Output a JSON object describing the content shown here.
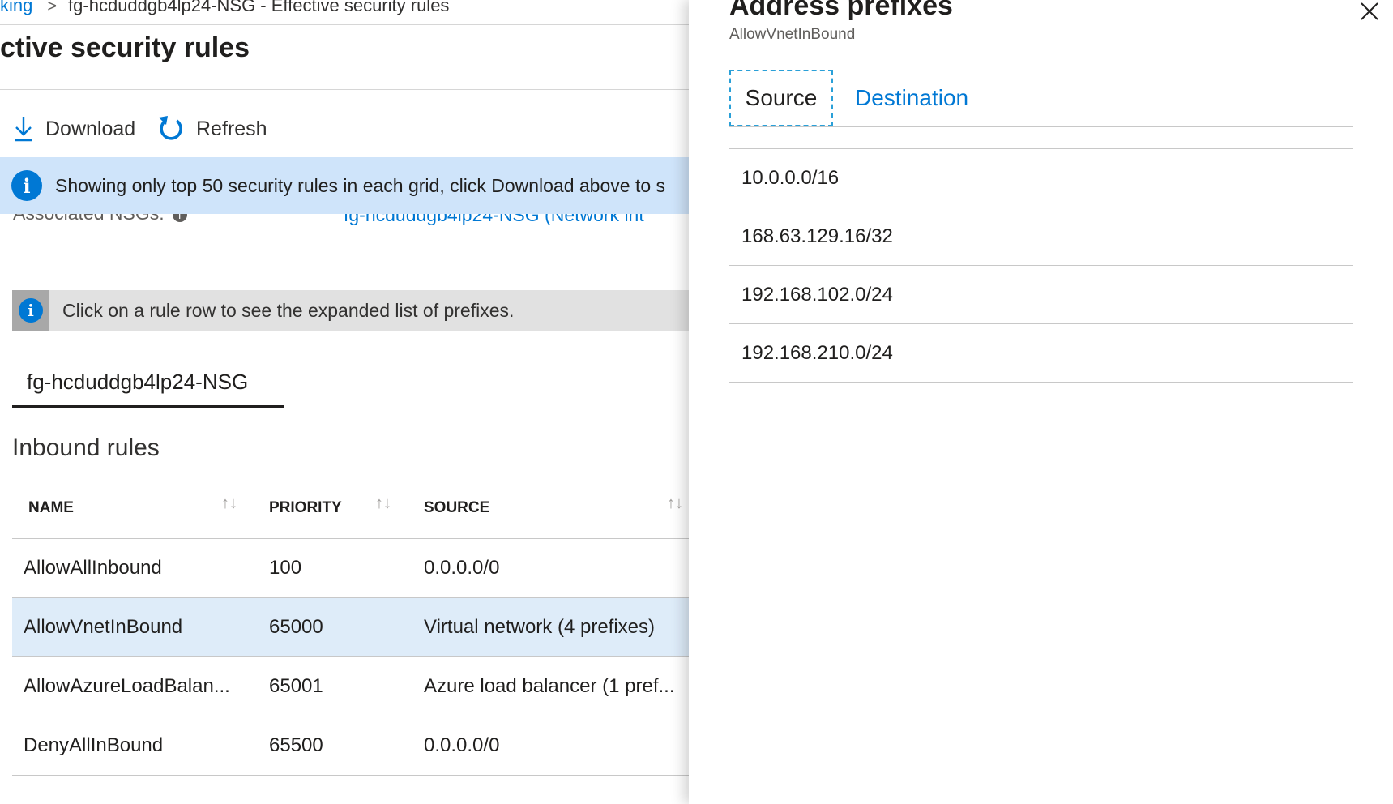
{
  "breadcrumb": {
    "link": "king",
    "separator": ">",
    "current": "fg-hcduddgb4lp24-NSG - Effective security rules"
  },
  "page": {
    "title": "ctive security rules"
  },
  "toolbar": {
    "download_label": "Download",
    "refresh_label": "Refresh"
  },
  "info_banner": {
    "text": "Showing only top 50 security rules in each grid, click Download above to s"
  },
  "associated": {
    "label": "Associated NSGs:",
    "value": "fg-hcduddgb4lp24-NSG (Network int"
  },
  "hint_banner": {
    "text": "Click on a rule row to see the expanded list of prefixes."
  },
  "nsg_tab": {
    "label": "fg-hcduddgb4lp24-NSG"
  },
  "inbound": {
    "title": "Inbound rules",
    "columns": [
      "NAME",
      "PRIORITY",
      "SOURCE"
    ],
    "sort_glyph": "↑↓",
    "rows": [
      {
        "name": "AllowAllInbound",
        "priority": "100",
        "source": "0.0.0.0/0"
      },
      {
        "name": "AllowVnetInBound",
        "priority": "65000",
        "source": "Virtual network (4 prefixes)"
      },
      {
        "name": "AllowAzureLoadBalan...",
        "priority": "65001",
        "source": "Azure load balancer (1 pref..."
      },
      {
        "name": "DenyAllInBound",
        "priority": "65500",
        "source": "0.0.0.0/0"
      }
    ]
  },
  "panel": {
    "title": "Address prefixes",
    "subtitle": "AllowVnetInBound",
    "tabs": [
      "Source",
      "Destination"
    ],
    "selected_tab": "Source",
    "prefixes": [
      "10.0.0.0/16",
      "168.63.129.16/32",
      "192.168.102.0/24",
      "192.168.210.0/24"
    ]
  },
  "colors": {
    "accent": "#0078d4",
    "info_banner_bg": "#cfe4fa",
    "hint_banner_bg": "#e1e1e1",
    "selected_row_bg": "#deecf9"
  },
  "icons": [
    "download-icon",
    "refresh-icon",
    "info-icon",
    "help-icon",
    "sort-icon",
    "close-icon"
  ]
}
